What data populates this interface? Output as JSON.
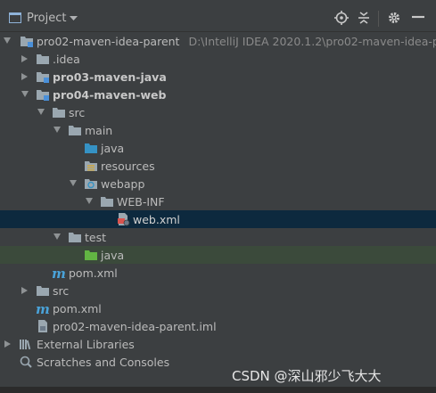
{
  "header": {
    "title": "Project"
  },
  "tree": {
    "root_label": "pro02-maven-idea-parent",
    "root_path": "D:\\IntelliJ IDEA 2020.1.2\\pro02-maven-idea-pare",
    "idea": ".idea",
    "pro03": "pro03-maven-java",
    "pro04": "pro04-maven-web",
    "src": "src",
    "main": "main",
    "java": "java",
    "resources": "resources",
    "webapp": "webapp",
    "webinf": "WEB-INF",
    "webxml": "web.xml",
    "test": "test",
    "test_java": "java",
    "pom_inner": "pom.xml",
    "src_root": "src",
    "pom_root": "pom.xml",
    "iml": "pro02-maven-idea-parent.iml",
    "ext_libs": "External Libraries",
    "scratches": "Scratches and Consoles"
  },
  "watermark": "CSDN @深山邪少飞大大"
}
